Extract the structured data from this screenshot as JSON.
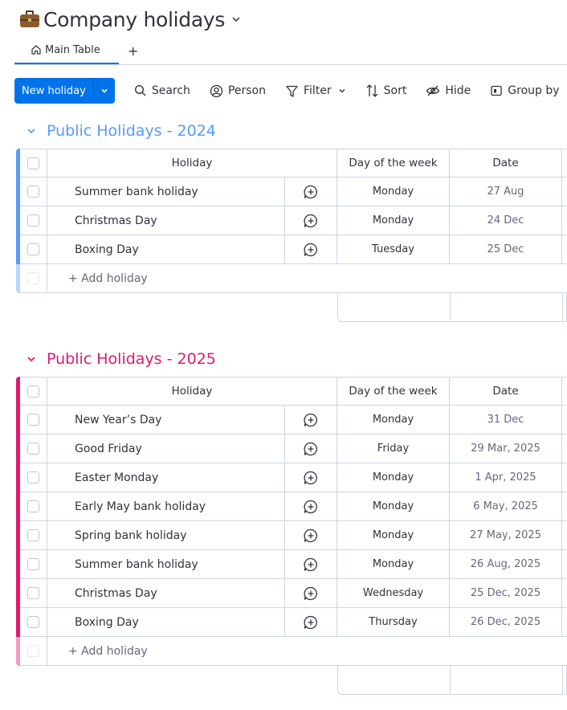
{
  "header": {
    "title": "Company holidays"
  },
  "tabs": {
    "main_label": "Main Table",
    "add_label": "+"
  },
  "toolbar": {
    "new_label": "New holiday",
    "search_label": "Search",
    "person_label": "Person",
    "filter_label": "Filter",
    "sort_label": "Sort",
    "hide_label": "Hide",
    "group_label": "Group by"
  },
  "colors": {
    "accent": "#0073ea",
    "group_2024": "#579bfc",
    "group_2025": "#e2186f"
  },
  "columns": {
    "holiday": "Holiday",
    "day": "Day of the week",
    "date": "Date"
  },
  "add_row_label": "+ Add holiday",
  "groups": [
    {
      "title": "Public Holidays - 2024",
      "rows": [
        {
          "name": "Summer bank holiday",
          "day": "Monday",
          "date": "27 Aug"
        },
        {
          "name": "Christmas Day",
          "day": "Monday",
          "date": "24 Dec"
        },
        {
          "name": "Boxing Day",
          "day": "Tuesday",
          "date": "25 Dec"
        }
      ]
    },
    {
      "title": "Public Holidays - 2025",
      "rows": [
        {
          "name": "New Year’s Day",
          "day": "Monday",
          "date": "31 Dec"
        },
        {
          "name": "Good Friday",
          "day": "Friday",
          "date": "29 Mar, 2025"
        },
        {
          "name": "Easter Monday",
          "day": "Monday",
          "date": "1 Apr, 2025"
        },
        {
          "name": "Early May bank holiday",
          "day": "Monday",
          "date": "6 May, 2025"
        },
        {
          "name": "Spring bank holiday",
          "day": "Monday",
          "date": "27 May, 2025"
        },
        {
          "name": "Summer bank holiday",
          "day": "Monday",
          "date": "26 Aug, 2025"
        },
        {
          "name": "Christmas Day",
          "day": "Wednesday",
          "date": "25 Dec, 2025"
        },
        {
          "name": "Boxing Day",
          "day": "Thursday",
          "date": "26 Dec, 2025"
        }
      ]
    }
  ]
}
